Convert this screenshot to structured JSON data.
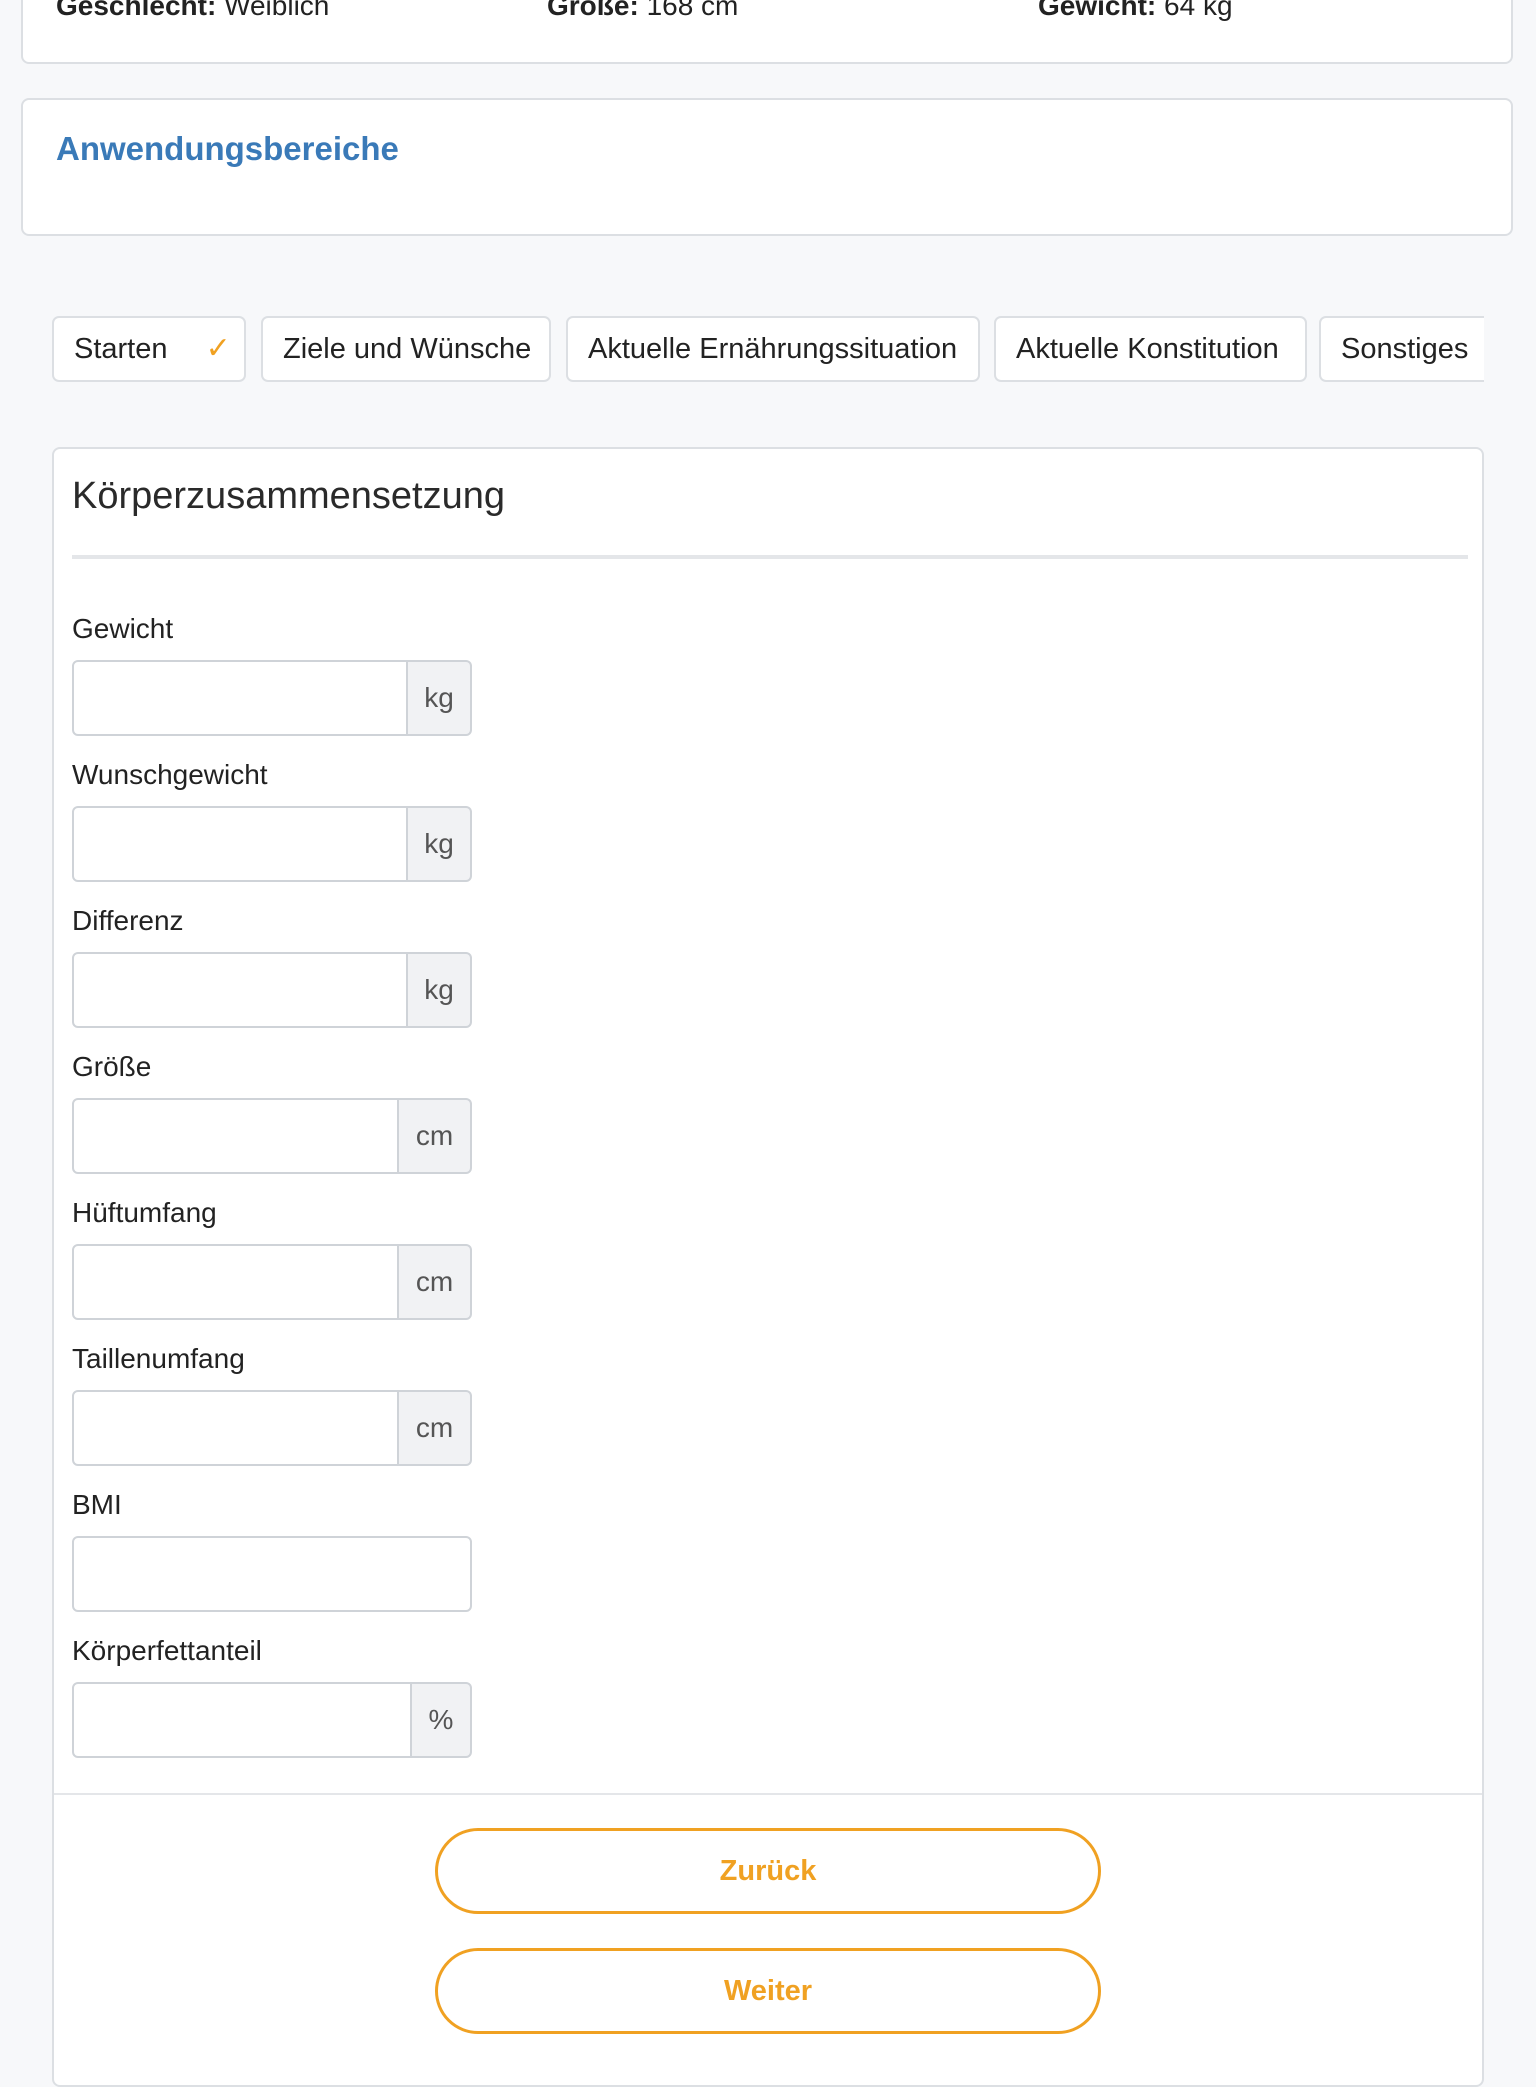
{
  "profile": {
    "gender_label": "Geschlecht:",
    "gender_value": "Weiblich",
    "height_label": "Größe:",
    "height_value": "168 cm",
    "weight_label": "Gewicht:",
    "weight_value": "64 kg"
  },
  "areas": {
    "title": "Anwendungsbereiche"
  },
  "tabs": [
    {
      "label": "Starten",
      "completed": true
    },
    {
      "label": "Ziele und Wünsche"
    },
    {
      "label": "Aktuelle Ernährungssituation"
    },
    {
      "label": "Aktuelle Konstitution"
    },
    {
      "label": "Sonstiges"
    }
  ],
  "check_icon": "✓",
  "form": {
    "title": "Körperzusammensetzung",
    "fields": [
      {
        "label": "Gewicht",
        "value": "",
        "unit": "kg"
      },
      {
        "label": "Wunschgewicht",
        "value": "",
        "unit": "kg"
      },
      {
        "label": "Differenz",
        "value": "",
        "unit": "kg"
      },
      {
        "label": "Größe",
        "value": "",
        "unit": "cm"
      },
      {
        "label": "Hüftumfang",
        "value": "",
        "unit": "cm"
      },
      {
        "label": "Taillenumfang",
        "value": "",
        "unit": "cm"
      },
      {
        "label": "BMI",
        "value": ""
      },
      {
        "label": "Körperfettanteil",
        "value": "",
        "unit": "%"
      }
    ]
  },
  "buttons": {
    "back": "Zurück",
    "next": "Weiter"
  },
  "colors": {
    "accent": "#f0a122",
    "link_blue": "#3a7ab8",
    "border": "#dcdfe3"
  }
}
